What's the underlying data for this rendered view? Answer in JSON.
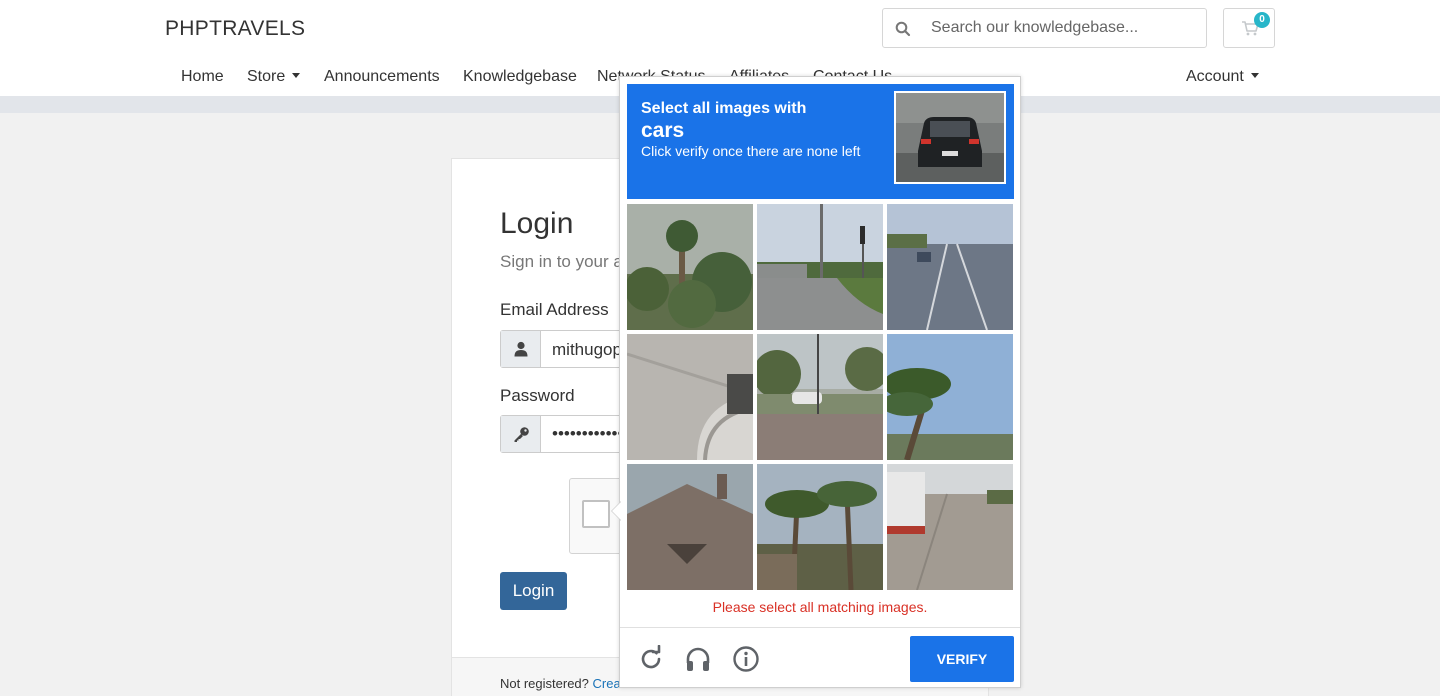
{
  "header": {
    "brand": "PHPTRAVELS",
    "search_placeholder": "Search our knowledgebase...",
    "cart_count": "0"
  },
  "nav": {
    "items": [
      {
        "label": "Home"
      },
      {
        "label": "Store",
        "dropdown": true
      },
      {
        "label": "Announcements"
      },
      {
        "label": "Knowledgebase"
      },
      {
        "label": "Network Status"
      },
      {
        "label": "Affiliates"
      },
      {
        "label": "Contact Us"
      }
    ],
    "account": "Account"
  },
  "login": {
    "title": "Login",
    "subtitle": "Sign in to your a",
    "email_label": "Email Address",
    "email_value": "mithugop",
    "password_label": "Password",
    "password_value": "••••••••••••",
    "button": "Login",
    "footer_text": "Not registered?",
    "footer_link": "Crea"
  },
  "captcha": {
    "line1": "Select all images with",
    "line2": "cars",
    "line3": "Click verify once there are none left",
    "error": "Please select all matching images.",
    "verify": "VERIFY",
    "accent": "#1a73e8",
    "error_color": "#d93025",
    "tiles": [
      {
        "subject": "palm trees and shrubs"
      },
      {
        "subject": "road intersection with traffic light"
      },
      {
        "subject": "highway with car"
      },
      {
        "subject": "pavement with curb"
      },
      {
        "subject": "street with white car"
      },
      {
        "subject": "palm tree against sky"
      },
      {
        "subject": "house roof"
      },
      {
        "subject": "palm trees by building"
      },
      {
        "subject": "highway with truck"
      }
    ],
    "footer_icons": [
      "reload-icon",
      "audio-icon",
      "info-icon"
    ]
  }
}
